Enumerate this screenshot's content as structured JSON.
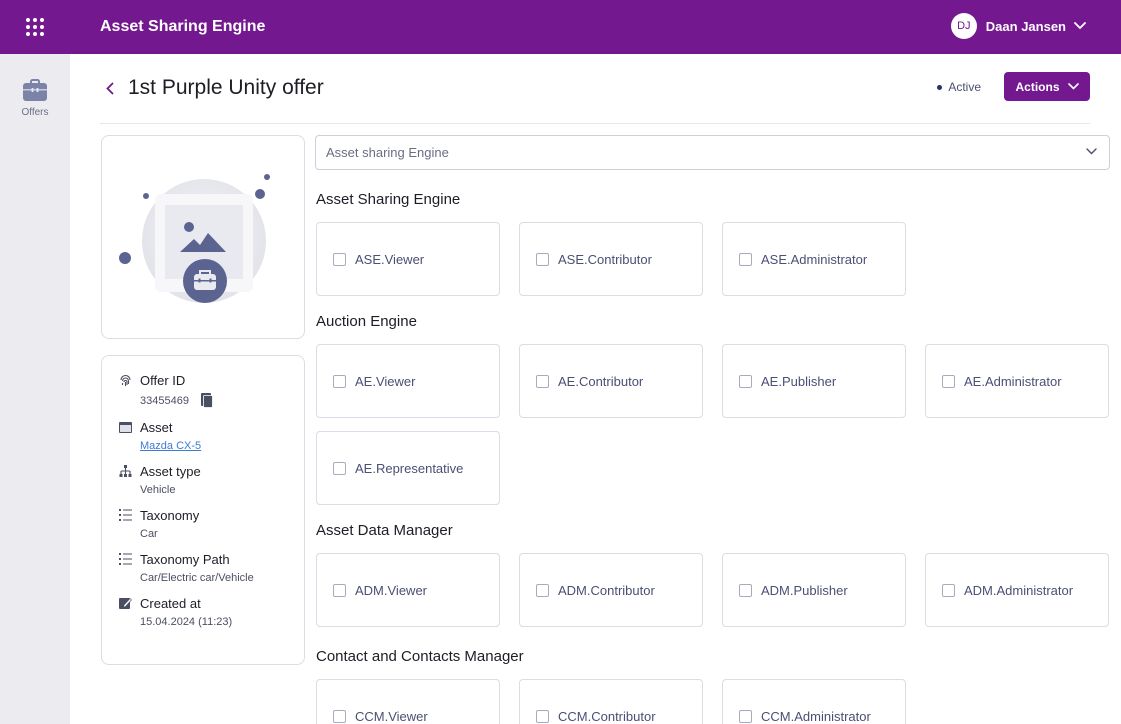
{
  "app": {
    "title": "Asset Sharing Engine"
  },
  "user": {
    "initials": "DJ",
    "name": "Daan Jansen"
  },
  "sidebar": {
    "items": [
      {
        "label": "Offers",
        "icon": "briefcase-icon"
      }
    ]
  },
  "page": {
    "title": "1st Purple Unity offer",
    "status": "Active",
    "actions_label": "Actions"
  },
  "engine_select": {
    "value": "Asset sharing Engine"
  },
  "info": {
    "offer_id_label": "Offer ID",
    "offer_id": "33455469",
    "asset_label": "Asset",
    "asset": "Mazda CX-5",
    "asset_type_label": "Asset type",
    "asset_type": "Vehicle",
    "taxonomy_label": "Taxonomy",
    "taxonomy": "Car",
    "taxonomy_path_label": "Taxonomy Path",
    "taxonomy_path": "Car/Electric car/Vehicle",
    "created_label": "Created at",
    "created": "15.04.2024 (11:23)"
  },
  "sections": [
    {
      "title": "Asset Sharing Engine",
      "roles": [
        "ASE.Viewer",
        "ASE.Contributor",
        "ASE.Administrator"
      ]
    },
    {
      "title": "Auction Engine",
      "roles": [
        "AE.Viewer",
        "AE.Contributor",
        "AE.Publisher",
        "AE.Administrator",
        "AE.Representative"
      ]
    },
    {
      "title": "Asset Data Manager",
      "roles": [
        "ADM.Viewer",
        "ADM.Contributor",
        "ADM.Publisher",
        "ADM.Administrator"
      ]
    },
    {
      "title": "Contact and Contacts Manager",
      "roles": [
        "CCM.Viewer",
        "CCM.Contributor",
        "CCM.Administrator"
      ]
    }
  ],
  "colors": {
    "brand": "#73188f",
    "link": "#3d7ad6",
    "illustration": "#5b6390"
  }
}
